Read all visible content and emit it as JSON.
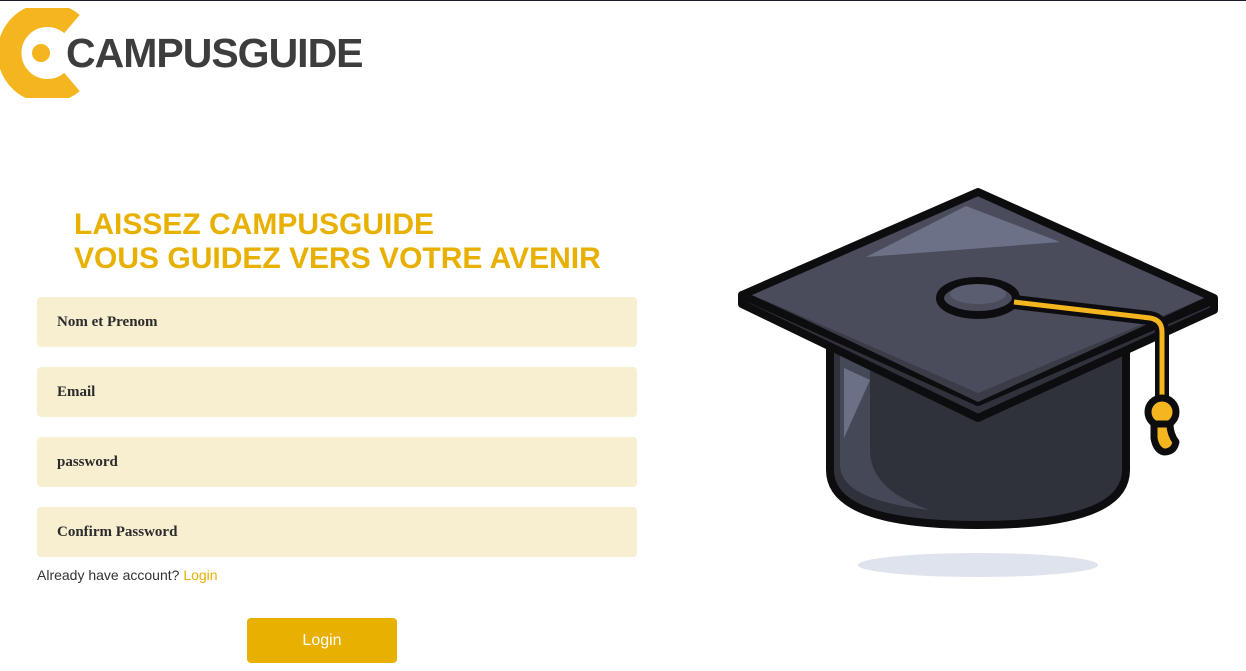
{
  "brand": {
    "name": "CAMPUSGUIDE",
    "logo_color": "#f5b51e",
    "text_color": "#3d3d3d"
  },
  "headline": {
    "line1": "LAISSEZ CAMPUSGUIDE",
    "line2": "VOUS GUIDEZ VERS VOTRE AVENIR",
    "color": "#e8b000"
  },
  "form": {
    "fields": [
      {
        "placeholder": "Nom et Prenom",
        "value": ""
      },
      {
        "placeholder": "Email",
        "value": ""
      },
      {
        "placeholder": "password",
        "value": ""
      },
      {
        "placeholder": "Confirm Password",
        "value": ""
      }
    ],
    "field_bg": "#f8efd1",
    "account_prompt": "Already have account?",
    "login_link": "Login",
    "submit_label": "Login",
    "accent": "#e8b000"
  },
  "illustration": {
    "icon": "graduation-cap-icon"
  }
}
